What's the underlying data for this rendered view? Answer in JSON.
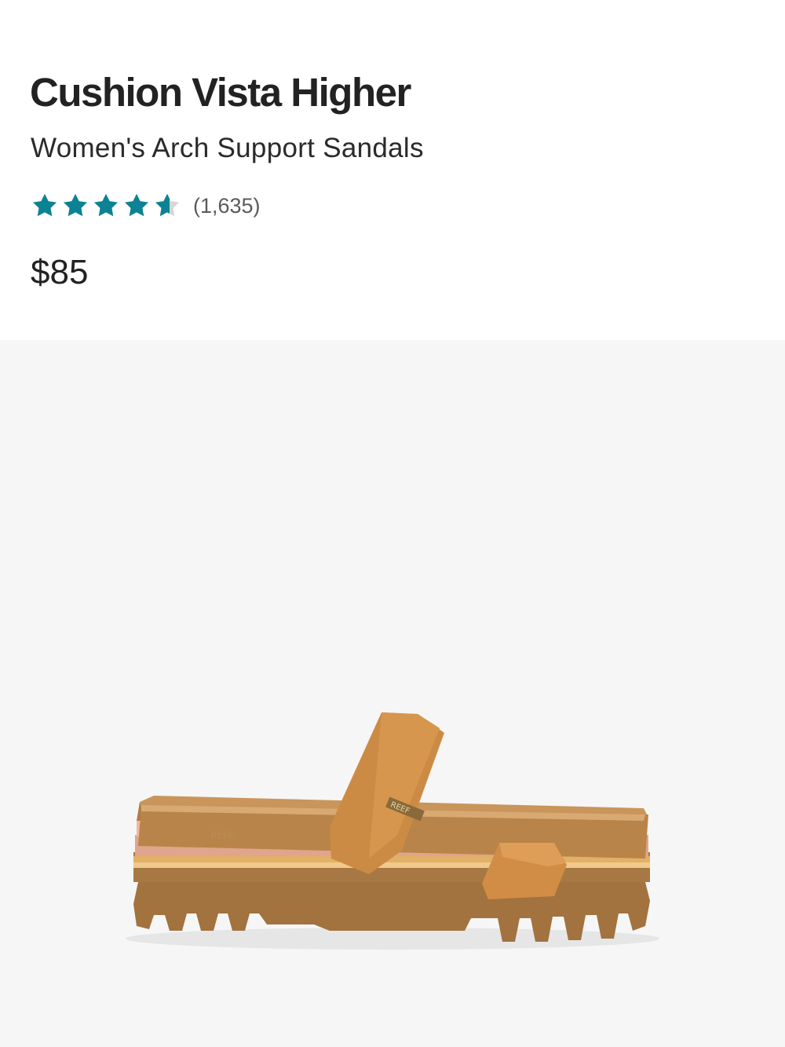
{
  "product": {
    "title": "Cushion Vista Higher",
    "subtitle": "Women's Arch Support Sandals",
    "rating": {
      "value": 4.6,
      "max": 5,
      "count_label": "(1,635)",
      "star_color": "#0c8294",
      "empty_star_color": "#d6d6d6"
    },
    "price": "$85",
    "image": {
      "icon": "sandal-product-image"
    }
  }
}
